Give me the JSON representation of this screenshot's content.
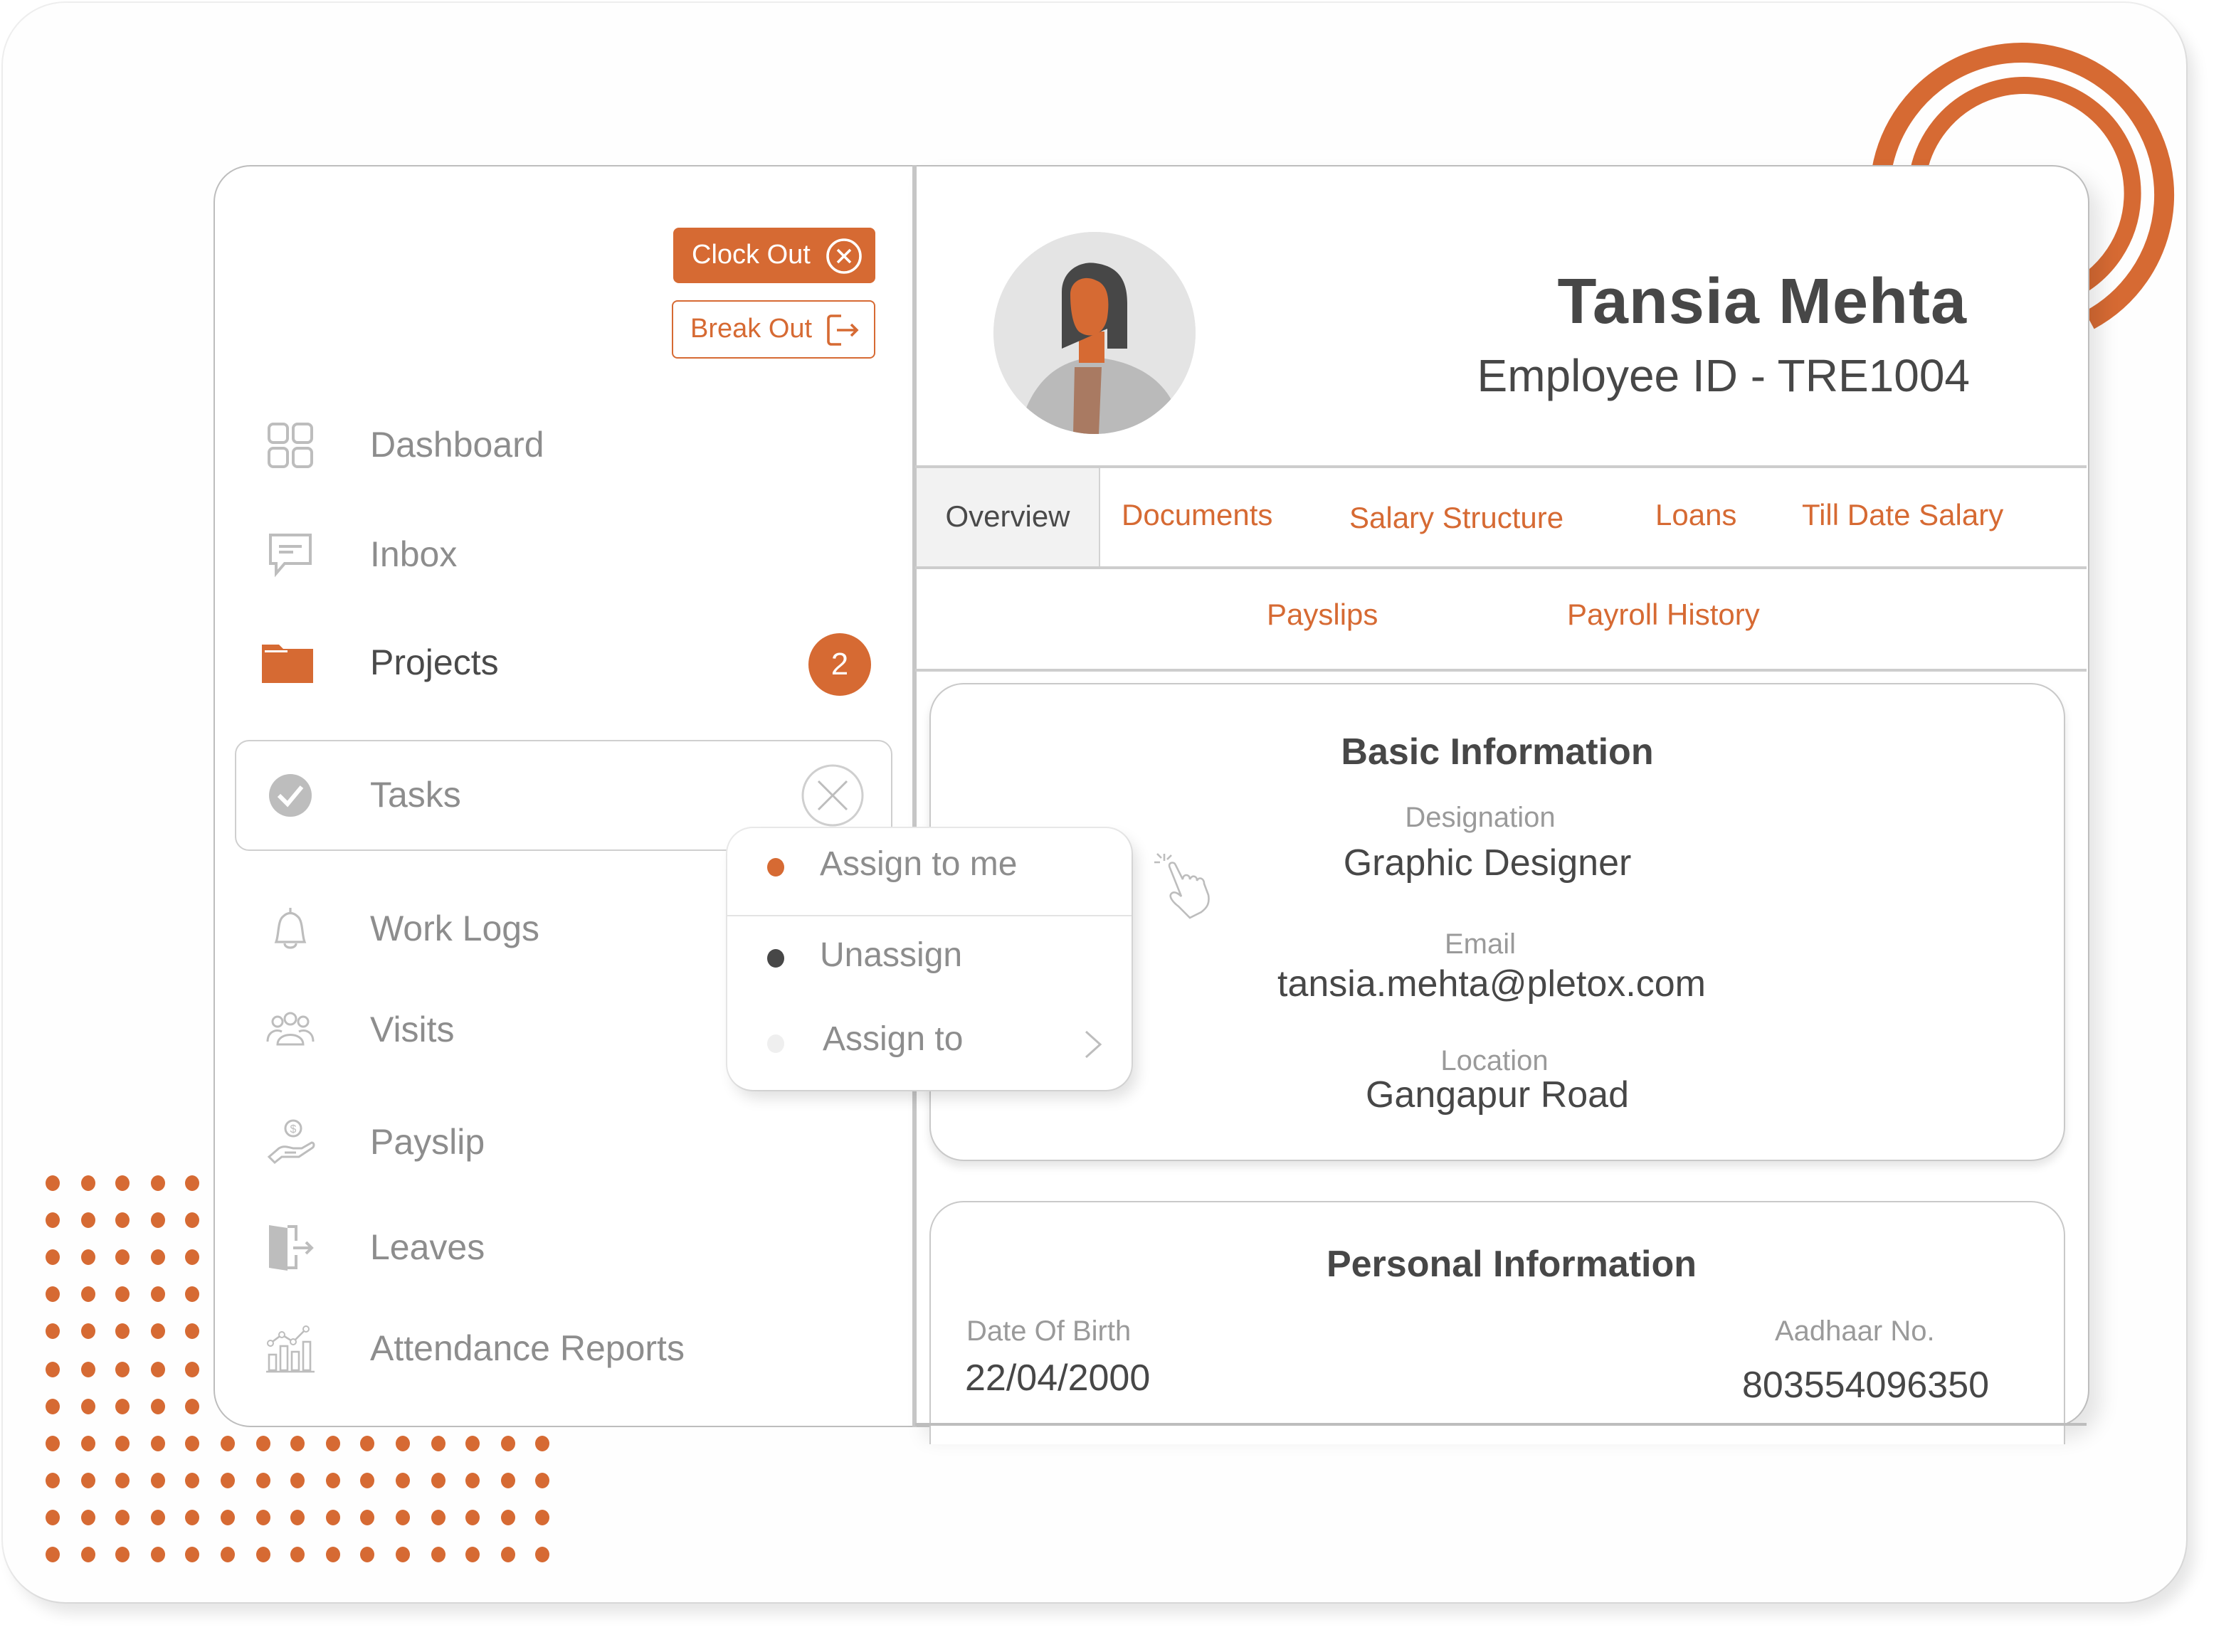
{
  "colors": {
    "accent": "#d66a33",
    "text_dark": "#474747",
    "text_muted": "#8d8d8d",
    "border": "#bdbdbd"
  },
  "sidebar": {
    "clock_out_label": "Clock Out",
    "break_out_label": "Break Out",
    "items": [
      {
        "label": "Dashboard",
        "icon": "dashboard-grid-icon"
      },
      {
        "label": "Inbox",
        "icon": "chat-message-icon"
      },
      {
        "label": "Projects",
        "icon": "folder-icon",
        "badge": "2",
        "active": true
      },
      {
        "label": "Tasks",
        "icon": "check-circle-icon",
        "expanded": true
      },
      {
        "label": "Work Logs",
        "icon": "bell-icon"
      },
      {
        "label": "Visits",
        "icon": "group-users-icon"
      },
      {
        "label": "Payslip",
        "icon": "hand-coin-icon"
      },
      {
        "label": "Leaves",
        "icon": "exit-door-icon"
      },
      {
        "label": "Attendance Reports",
        "icon": "bar-line-chart-icon"
      }
    ]
  },
  "task_menu": {
    "items": [
      {
        "label": "Assign to me",
        "dot_color": "#d66a33"
      },
      {
        "label": "Unassign",
        "dot_color": "#474747"
      },
      {
        "label": "Assign to",
        "dot_color": "#ededed",
        "has_submenu": true
      }
    ]
  },
  "profile": {
    "name": "Tansia Mehta",
    "employee_id_text": "Employee ID  - TRE1004"
  },
  "tabs": {
    "row1": [
      "Overview",
      "Documents",
      "Salary Structure",
      "Loans",
      "Till Date Salary"
    ],
    "row2": [
      "Payslips",
      "Payroll History"
    ],
    "active": "Overview"
  },
  "basic_info": {
    "title": "Basic Information",
    "designation_label": "Designation",
    "designation": "Graphic Designer",
    "email_label": "Email",
    "email": "tansia.mehta@pletox.com",
    "location_label": "Location",
    "location": "Gangapur Road"
  },
  "personal_info": {
    "title": "Personal Information",
    "dob_label": "Date Of Birth",
    "dob": "22/04/2000",
    "aadhaar_label": "Aadhaar No.",
    "aadhaar": "803554096350"
  }
}
